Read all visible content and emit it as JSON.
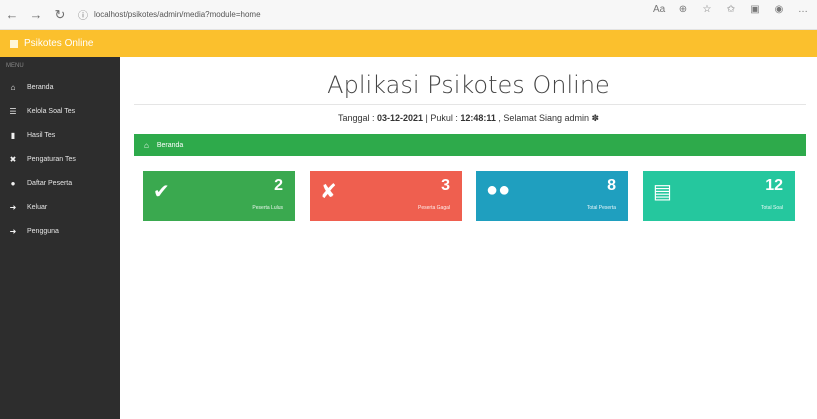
{
  "browser": {
    "back_icon": "arrow-left-icon",
    "forward_icon": "arrow-right-icon",
    "reload_icon": "reload-icon",
    "url": "localhost/psikotes/admin/media?module=home"
  },
  "topbar": {
    "brand": "Psikotes Online"
  },
  "sidebar": {
    "menu_label": "MENU",
    "items": [
      {
        "label": "Beranda",
        "icon": "home-icon"
      },
      {
        "label": "Kelola Soal Tes",
        "icon": "list-icon"
      },
      {
        "label": "Hasil Tes",
        "icon": "file-icon"
      },
      {
        "label": "Pengaturan Tes",
        "icon": "tools-icon"
      },
      {
        "label": "Daftar Peserta",
        "icon": "users-icon"
      },
      {
        "label": "Keluar",
        "icon": "sign-out-icon"
      },
      {
        "label": "Pengguna",
        "icon": "sign-in-icon"
      }
    ]
  },
  "main": {
    "title": "Aplikasi Psikotes Online",
    "date_prefix": "Tanggal : ",
    "date": "03-12-2021",
    "time_prefix": " | Pukul : ",
    "time": "12:48:11",
    "greeting": " , Selamat Siang admin ",
    "breadcrumb": "Beranda",
    "cards": [
      {
        "value": "2",
        "label": "Peserta Lulus",
        "color": "#3aa94f",
        "icon": "user-check-icon"
      },
      {
        "value": "3",
        "label": "Peserta Gagal",
        "color": "#ef5f4f",
        "icon": "user-slash-icon"
      },
      {
        "value": "8",
        "label": "Total Peserta",
        "color": "#1f9fbf",
        "icon": "users-icon"
      },
      {
        "value": "12",
        "label": "Total Soal",
        "color": "#25c79e",
        "icon": "file-text-icon"
      }
    ]
  }
}
